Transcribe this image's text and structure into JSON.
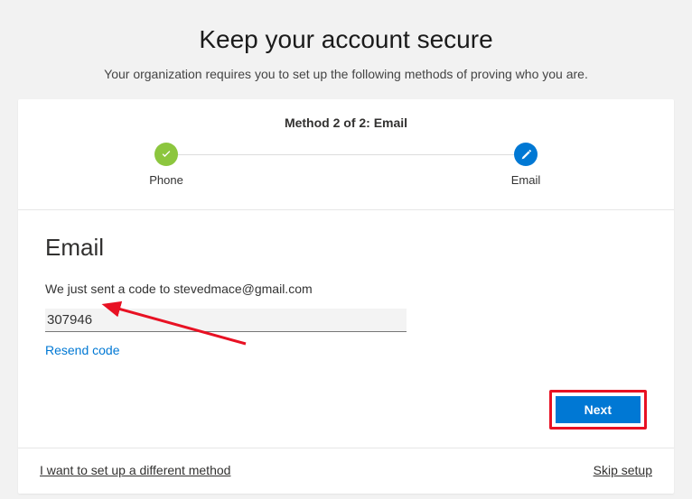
{
  "page": {
    "title": "Keep your account secure",
    "subtitle": "Your organization requires you to set up the following methods of proving who you are."
  },
  "header": {
    "method_label": "Method 2 of 2: Email",
    "steps": [
      {
        "label": "Phone",
        "state": "done"
      },
      {
        "label": "Email",
        "state": "active"
      }
    ]
  },
  "body": {
    "section_title": "Email",
    "sent_message": "We just sent a code to stevedmace@gmail.com",
    "code_value": "307946",
    "resend_label": "Resend code",
    "next_label": "Next"
  },
  "footer": {
    "different_method": "I want to set up a different method",
    "skip_setup": "Skip setup"
  },
  "colors": {
    "accent": "#0078d4",
    "success": "#8cc63e",
    "highlight": "#e81123"
  }
}
